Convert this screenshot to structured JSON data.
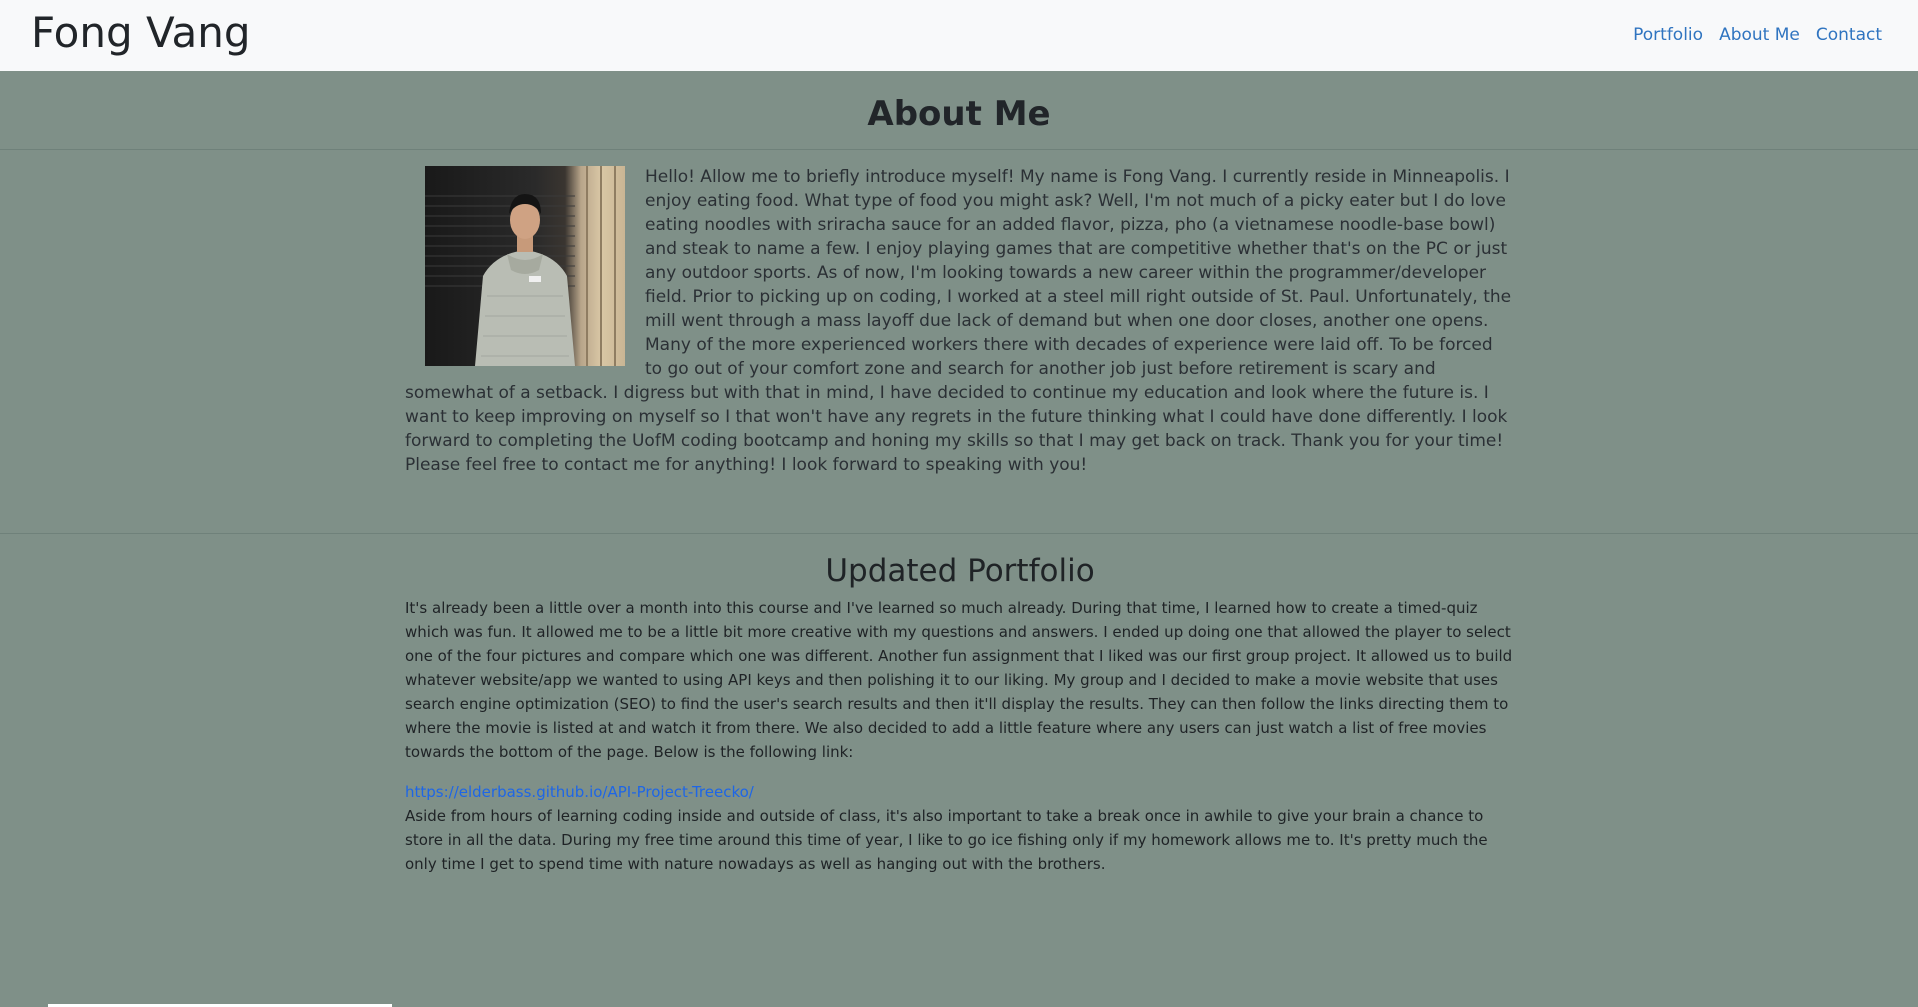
{
  "navbar": {
    "brand": "Fong Vang",
    "links": [
      "Portfolio",
      "About Me",
      "Contact"
    ]
  },
  "about": {
    "heading": "About Me",
    "text": "Hello! Allow me to briefly introduce myself! My name is Fong Vang. I currently reside in Minneapolis. I enjoy eating food. What type of food you might ask? Well, I'm not much of a picky eater but I do love eating noodles with sriracha sauce for an added flavor, pizza, pho (a vietnamese noodle-base bowl) and steak to name a few. I enjoy playing games that are competitive whether that's on the PC or just any outdoor sports. As of now, I'm looking towards a new career within the programmer/developer field. Prior to picking up on coding, I worked at a steel mill right outside of St. Paul. Unfortunately, the mill went through a mass layoff due lack of demand but when one door closes, another one opens. Many of the more experienced workers there with decades of experience were laid off. To be forced to go out of your comfort zone and search for another job just before retirement is scary and somewhat of a setback. I digress but with that in mind, I have decided to continue my education and look where the future is. I want to keep improving on myself so I that won't have any regrets in the future thinking what I could have done differently. I look forward to completing the UofM coding bootcamp and honing my skills so that I may get back on track. Thank you for your time! Please feel free to contact me for anything! I look forward to speaking with you!"
  },
  "portfolio": {
    "heading": "Updated Portfolio",
    "paragraph1": "It's already been a little over a month into this course and I've learned so much already. During that time, I learned how to create a timed-quiz which was fun. It allowed me to be a little bit more creative with my questions and answers. I ended up doing one that allowed the player to select one of the four pictures and compare which one was different. Another fun assignment that I liked was our first group project. It allowed us to build whatever website/app we wanted to using API keys and then polishing it to our liking. My group and I decided to make a movie website that uses search engine optimization (SEO) to find the user's search results and then it'll display the results. They can then follow the links directing them to where the movie is listed at and watch it from there. We also decided to add a little feature where any users can just watch a list of free movies towards the bottom of the page. Below is the following link:",
    "link": "https://elderbass.github.io/API-Project-Treecko/",
    "paragraph2": "Aside from hours of learning coding inside and outside of class, it's also important to take a break once in awhile to give your brain a chance to store in all the data. During my free time around this time of year, I like to go ice fishing only if my homework allows me to. It's pretty much the only time I get to spend time with nature nowadays as well as hanging out with the brothers."
  }
}
